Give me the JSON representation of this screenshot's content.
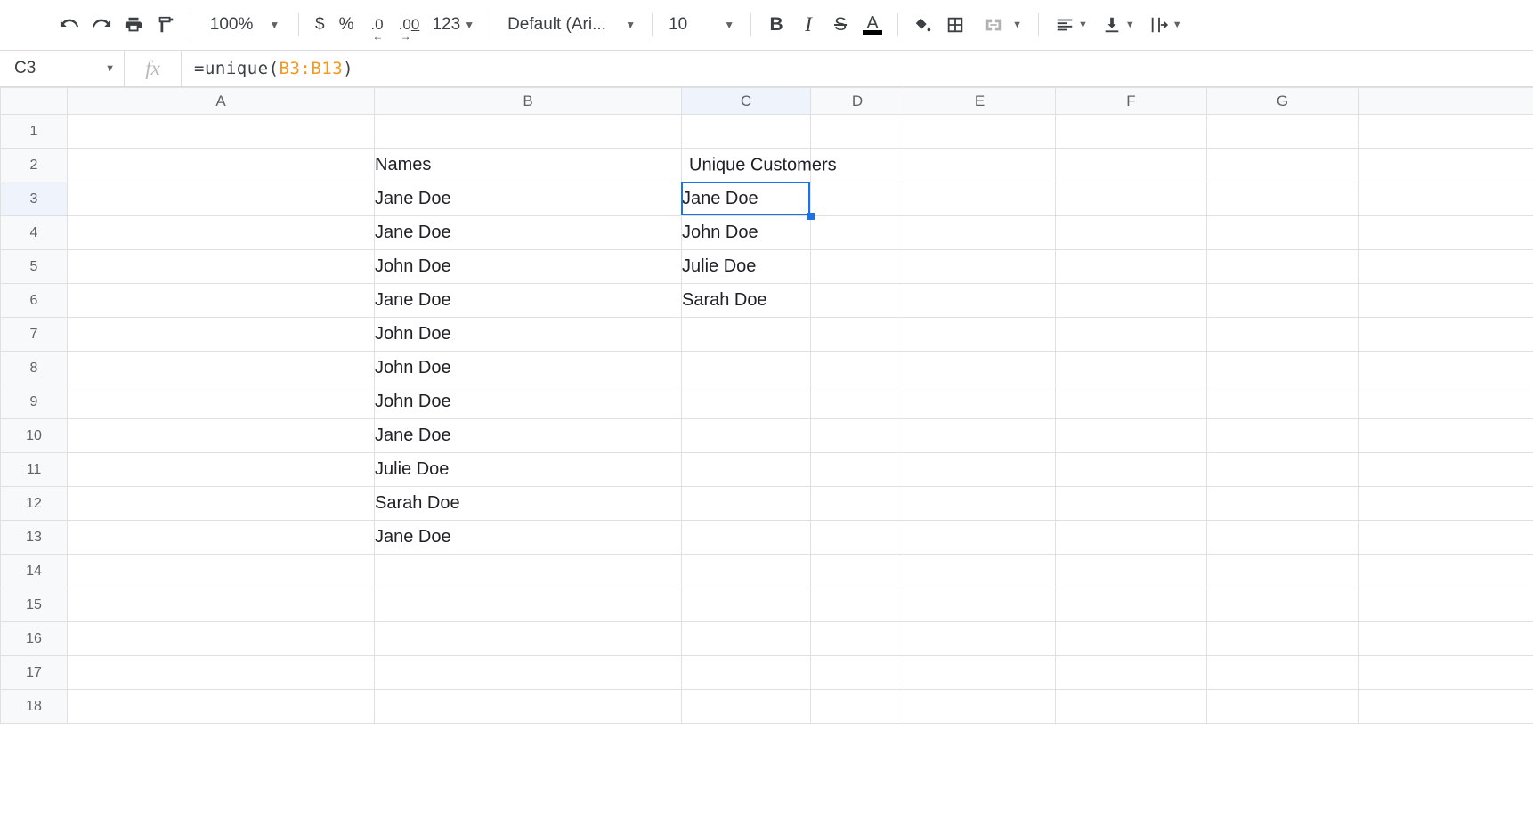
{
  "toolbar": {
    "zoom": "100%",
    "currency": "$",
    "percent": "%",
    "dec_dec": ".0",
    "inc_dec": ".00",
    "more_formats": "123",
    "font": "Default (Ari...",
    "font_size": "10",
    "bold": "B",
    "italic": "I",
    "strike": "S",
    "text_color_glyph": "A"
  },
  "formula_bar": {
    "cell_ref": "C3",
    "fx_label": "fx",
    "formula_prefix": "=unique(",
    "formula_range": "B3:B13",
    "formula_suffix": ")"
  },
  "columns": [
    "A",
    "B",
    "C",
    "D",
    "E",
    "F",
    "G",
    ""
  ],
  "rows": 18,
  "active_cell": {
    "col": "C",
    "row": 3
  },
  "cells": {
    "B2": "Names",
    "C2": "Unique Customers",
    "B3": "Jane Doe",
    "C3": "Jane Doe",
    "B4": "Jane Doe",
    "C4": "John Doe",
    "B5": "John Doe",
    "C5": "Julie Doe",
    "B6": "Jane Doe",
    "C6": "Sarah Doe",
    "B7": "John Doe",
    "B8": "John Doe",
    "B9": "John Doe",
    "B10": "Jane Doe",
    "B11": "Julie Doe",
    "B12": "Sarah Doe",
    "B13": "Jane Doe"
  },
  "overflow_cells": [
    "C2"
  ]
}
